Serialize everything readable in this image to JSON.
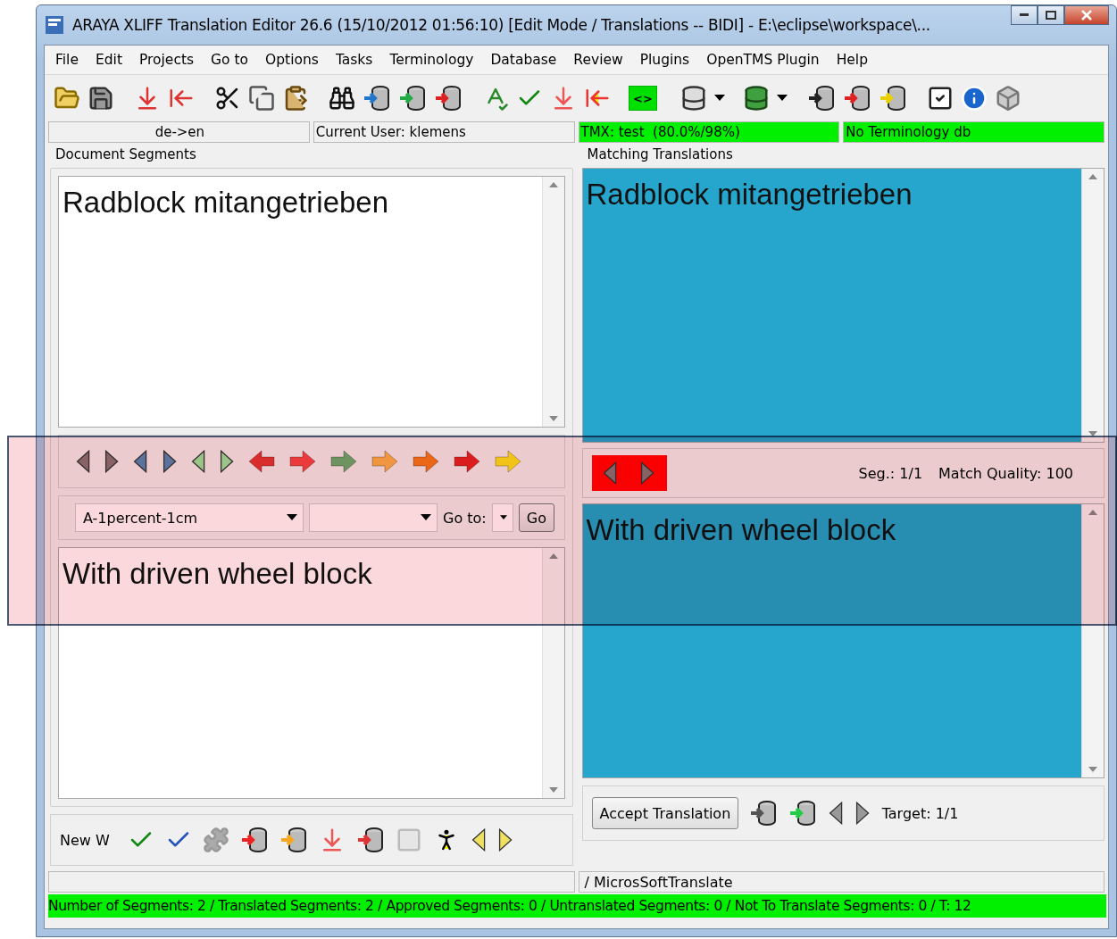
{
  "window": {
    "title": "ARAYA XLIFF Translation Editor 26.6 (15/10/2012 01:56:10) [Edit Mode / Translations -- BIDI] - E:\\eclipse\\workspace\\..."
  },
  "menu": [
    "File",
    "Edit",
    "Projects",
    "Go to",
    "Options",
    "Tasks",
    "Terminology",
    "Database",
    "Review",
    "Plugins",
    "OpenTMS Plugin",
    "Help"
  ],
  "tag_button": "<>",
  "info_bar": [
    {
      "text": "de->en",
      "highlighted": false
    },
    {
      "text": "Current User: klemens",
      "highlighted": false
    },
    {
      "text": "TMX: test  (80.0%/98%)",
      "highlighted": true
    },
    {
      "text": "No Terminology db",
      "highlighted": true
    }
  ],
  "document_segments": {
    "title": "Document Segments",
    "source": "Radblock mitangetrieben",
    "segment_select": "A-1percent-1cm",
    "goto_label": "Go to:",
    "go_button": "Go",
    "target": "With driven wheel block",
    "new_word_label": "New W"
  },
  "matching_translations": {
    "title": "Matching Translations",
    "source": "Radblock mitangetrieben",
    "seg": "Seg.: 1/1",
    "match_quality": "Match Quality: 100",
    "target": "With driven wheel block",
    "accept_button": "Accept Translation",
    "target_count": "Target: 1/1"
  },
  "status_bar": {
    "engine": "/ MicrosSoftTranslate",
    "summary": "Number of Segments: 2 /  Translated Segments: 2 /  Approved Segments: 0 /  Untranslated Segments: 0 / Not To Translate Segments: 0 / T: 12"
  },
  "highlight": {
    "shown": true
  }
}
